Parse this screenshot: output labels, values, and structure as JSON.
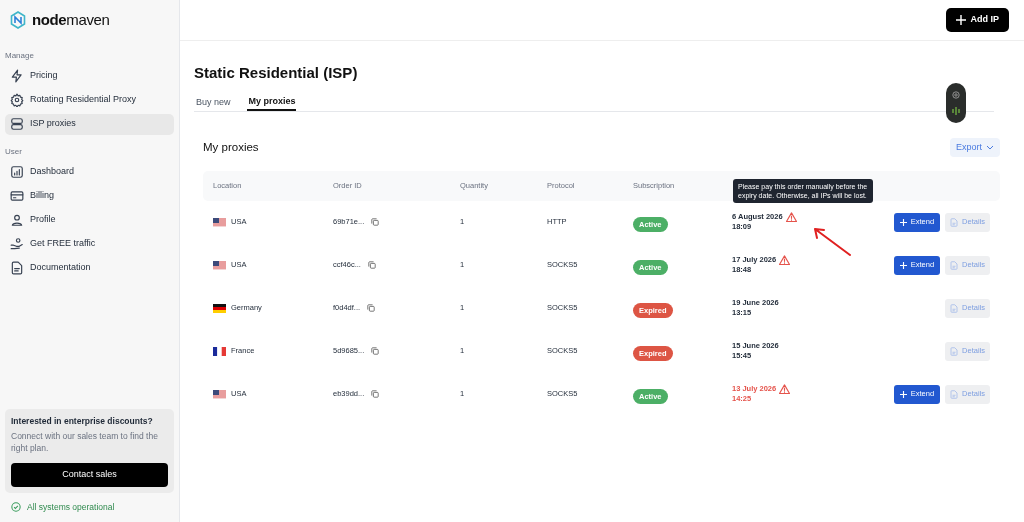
{
  "brand": {
    "name_bold": "node",
    "name_light": "maven"
  },
  "sidebar": {
    "sections": [
      {
        "title": "Manage",
        "items": [
          {
            "label": "Pricing",
            "kind": "bolt",
            "selected": false
          },
          {
            "label": "Rotating Residential Proxy",
            "kind": "gear",
            "selected": false
          },
          {
            "label": "ISP proxies",
            "kind": "server",
            "selected": true
          }
        ]
      },
      {
        "title": "User",
        "items": [
          {
            "label": "Dashboard",
            "kind": "chart",
            "selected": false
          },
          {
            "label": "Billing",
            "kind": "card",
            "selected": false
          },
          {
            "label": "Profile",
            "kind": "user",
            "selected": false
          },
          {
            "label": "Get FREE traffic",
            "kind": "gift",
            "selected": false
          },
          {
            "label": "Documentation",
            "kind": "doc",
            "selected": false
          }
        ]
      }
    ],
    "promo": {
      "title": "Interested in enterprise discounts?",
      "text": "Connect with our sales team to find the right plan.",
      "button": "Contact sales"
    },
    "status": "All systems operational"
  },
  "header": {
    "add_button": "Add IP"
  },
  "page": {
    "title": "Static Residential (ISP)",
    "tabs": [
      {
        "label": "Buy new",
        "selected": false
      },
      {
        "label": "My proxies",
        "selected": true
      }
    ]
  },
  "card": {
    "title": "My proxies",
    "export": "Export",
    "columns": [
      "Location",
      "Order ID",
      "Quantity",
      "Protocol",
      "Subscription"
    ],
    "rows": [
      {
        "location": {
          "label": "USA",
          "kind": "usa"
        },
        "order_id": "69b71e...",
        "quantity": "1",
        "protocol": "HTTP",
        "subscription": {
          "label": "Active",
          "kind": "active"
        },
        "date": "6 August 2026",
        "time": "18:09",
        "warning": true,
        "overdue": false,
        "extend": "Extend",
        "details": "Details"
      },
      {
        "location": {
          "label": "USA",
          "kind": "usa"
        },
        "order_id": "ccf46c...",
        "quantity": "1",
        "protocol": "SOCKS5",
        "subscription": {
          "label": "Active",
          "kind": "active"
        },
        "date": "17 July 2026",
        "time": "18:48",
        "warning": true,
        "overdue": false,
        "extend": "Extend",
        "details": "Details"
      },
      {
        "location": {
          "label": "Germany",
          "kind": "germany"
        },
        "order_id": "f0d4df...",
        "quantity": "1",
        "protocol": "SOCKS5",
        "subscription": {
          "label": "Expired",
          "kind": "expired"
        },
        "date": "19 June 2026",
        "time": "13:15",
        "warning": false,
        "overdue": false,
        "details": "Details"
      },
      {
        "location": {
          "label": "France",
          "kind": "france"
        },
        "order_id": "5d9685...",
        "quantity": "1",
        "protocol": "SOCKS5",
        "subscription": {
          "label": "Expired",
          "kind": "expired"
        },
        "date": "15 June 2026",
        "time": "15:45",
        "warning": false,
        "overdue": false,
        "details": "Details"
      },
      {
        "location": {
          "label": "USA",
          "kind": "usa"
        },
        "order_id": "eb39dd...",
        "quantity": "1",
        "protocol": "SOCKS5",
        "subscription": {
          "label": "Active",
          "kind": "active"
        },
        "date": "13 July 2026",
        "time": "14:25",
        "warning": true,
        "overdue": true,
        "extend": "Extend",
        "details": "Details"
      }
    ],
    "tooltip": "Please pay this order manually before the expiry date. Otherwise, all IPs will be lost."
  }
}
